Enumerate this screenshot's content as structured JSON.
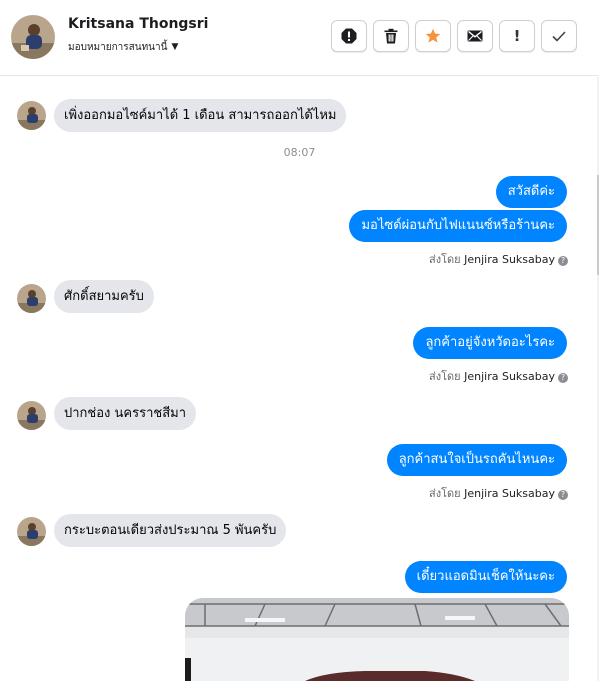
{
  "header": {
    "contact_name": "Kritsana Thongsri",
    "assign_label": "มอบหมายการสนทนานี้",
    "toolbar": {
      "spam": "spam-icon",
      "delete": "trash-icon",
      "star": "star-icon",
      "unread": "envelope-icon",
      "follow_up": "exclamation-icon",
      "done": "checkmark-icon",
      "follow_up_glyph": "!",
      "done_glyph": "✓"
    },
    "star_color": "#f7923a"
  },
  "conversation": {
    "timestamp": "08:07",
    "messages": [
      {
        "from": "customer",
        "text": "เพิ่งออกมอไซค์มาได้ 1 เดือน สามารถออกได้ไหม"
      },
      {
        "from": "page",
        "text": "สวัสดีค่ะ"
      },
      {
        "from": "page",
        "text": "มอไซด์ผ่อนกับไฟแนนซ์หรือร้านคะ"
      },
      {
        "from": "customer",
        "text": "ศักดิ์สยามครับ"
      },
      {
        "from": "page",
        "text": "ลูกค้าอยู่จังหวัดอะไรคะ"
      },
      {
        "from": "customer",
        "text": "ปากช่อง นครราชสีมา"
      },
      {
        "from": "page",
        "text": "ลูกค้าสนใจเป็นรถคันไหนคะ"
      },
      {
        "from": "customer",
        "text": "กระบะตอนเดียวส่งประมาณ 5 พันครับ"
      },
      {
        "from": "page",
        "text": "เดี๋ยวแอดมินเช็คให้นะคะ"
      }
    ],
    "sent_by_prefix": "ส่งโดย",
    "agent_name": "Jenjira Suksabay",
    "outgoing_color": "#0084ff",
    "incoming_color": "#e4e6eb"
  }
}
